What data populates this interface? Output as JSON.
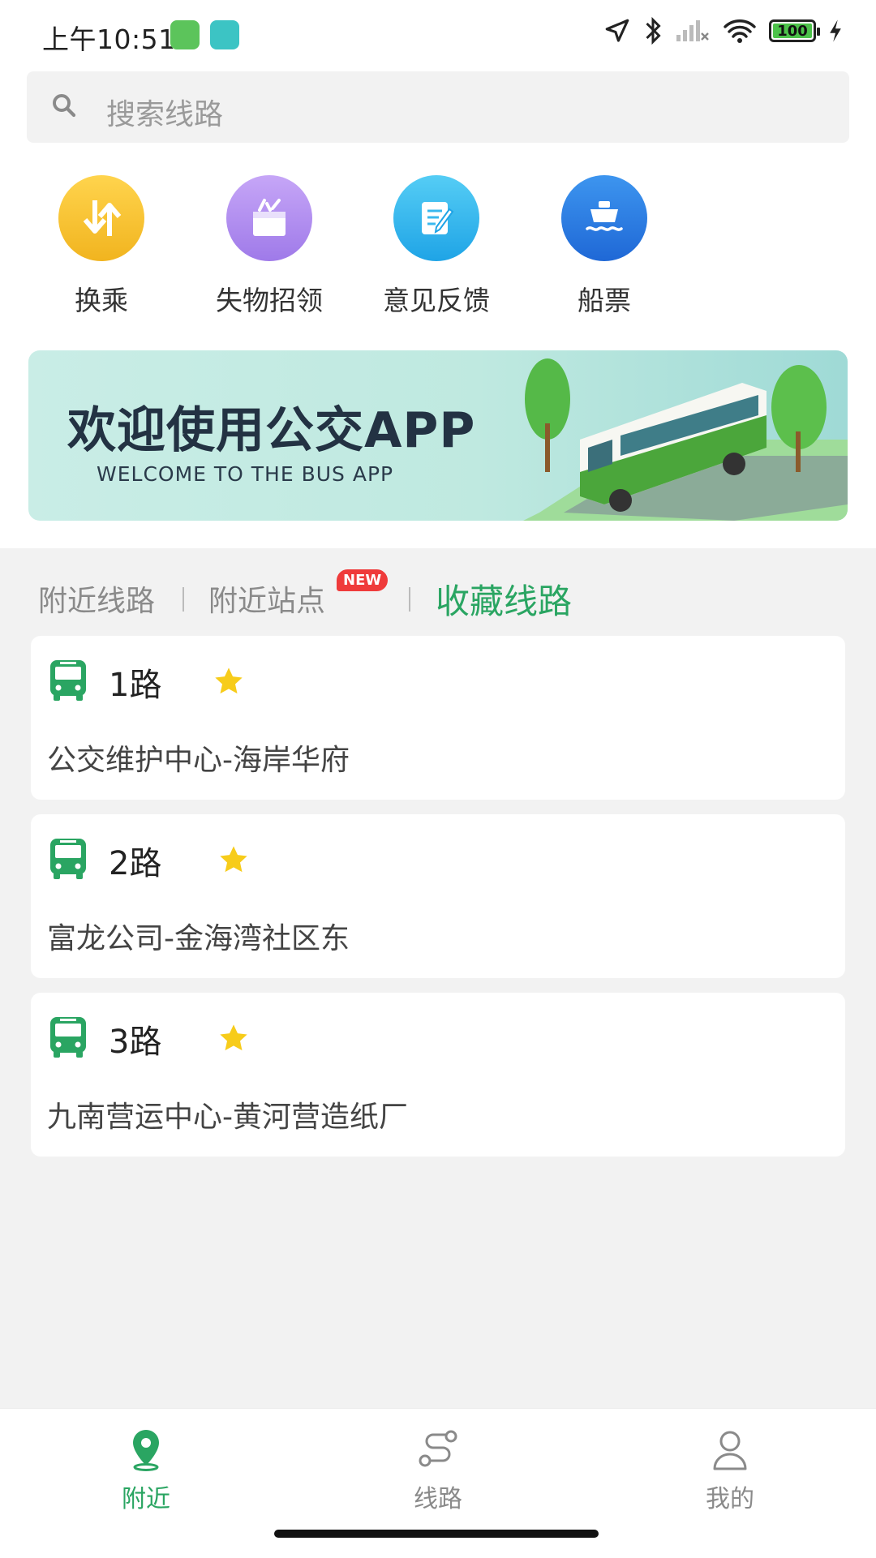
{
  "status_bar": {
    "time": "上午10:51",
    "battery": "100",
    "colors": {
      "ind1": "#5cc45b",
      "ind2": "#3cc4c4"
    },
    "icons": [
      "location-arrow-icon",
      "bluetooth-icon",
      "signal-off-icon",
      "wifi-icon",
      "battery-icon",
      "charging-bolt-icon"
    ]
  },
  "search": {
    "placeholder": "搜索线路",
    "icon": "search-icon"
  },
  "quick_actions": [
    {
      "label": "换乘",
      "icon": "transfer-icon",
      "color": "#f4c12e"
    },
    {
      "label": "失物招领",
      "icon": "lost-found-icon",
      "color": "#b18cf0"
    },
    {
      "label": "意见反馈",
      "icon": "feedback-icon",
      "color": "#39b8ee"
    },
    {
      "label": "船票",
      "icon": "ship-icon",
      "color": "#2f7fe3"
    }
  ],
  "banner": {
    "title": "欢迎使用公交APP",
    "subtitle": "WELCOME TO THE BUS APP"
  },
  "tabs": {
    "nearby_routes": "附近线路",
    "nearby_stops": "附近站点",
    "new_badge": "NEW",
    "favorite_routes": "收藏线路",
    "active": "favorite_routes",
    "accent_color": "#2aa562"
  },
  "favorites": [
    {
      "route": "1路",
      "desc": "公交维护中心-海岸华府"
    },
    {
      "route": "2路",
      "desc": "富龙公司-金海湾社区东"
    },
    {
      "route": "3路",
      "desc": "九南营运中心-黄河营造纸厂"
    }
  ],
  "bottom_nav": [
    {
      "label": "附近",
      "icon": "location-pin-icon",
      "active": true
    },
    {
      "label": "线路",
      "icon": "route-icon",
      "active": false
    },
    {
      "label": "我的",
      "icon": "user-icon",
      "active": false
    }
  ]
}
